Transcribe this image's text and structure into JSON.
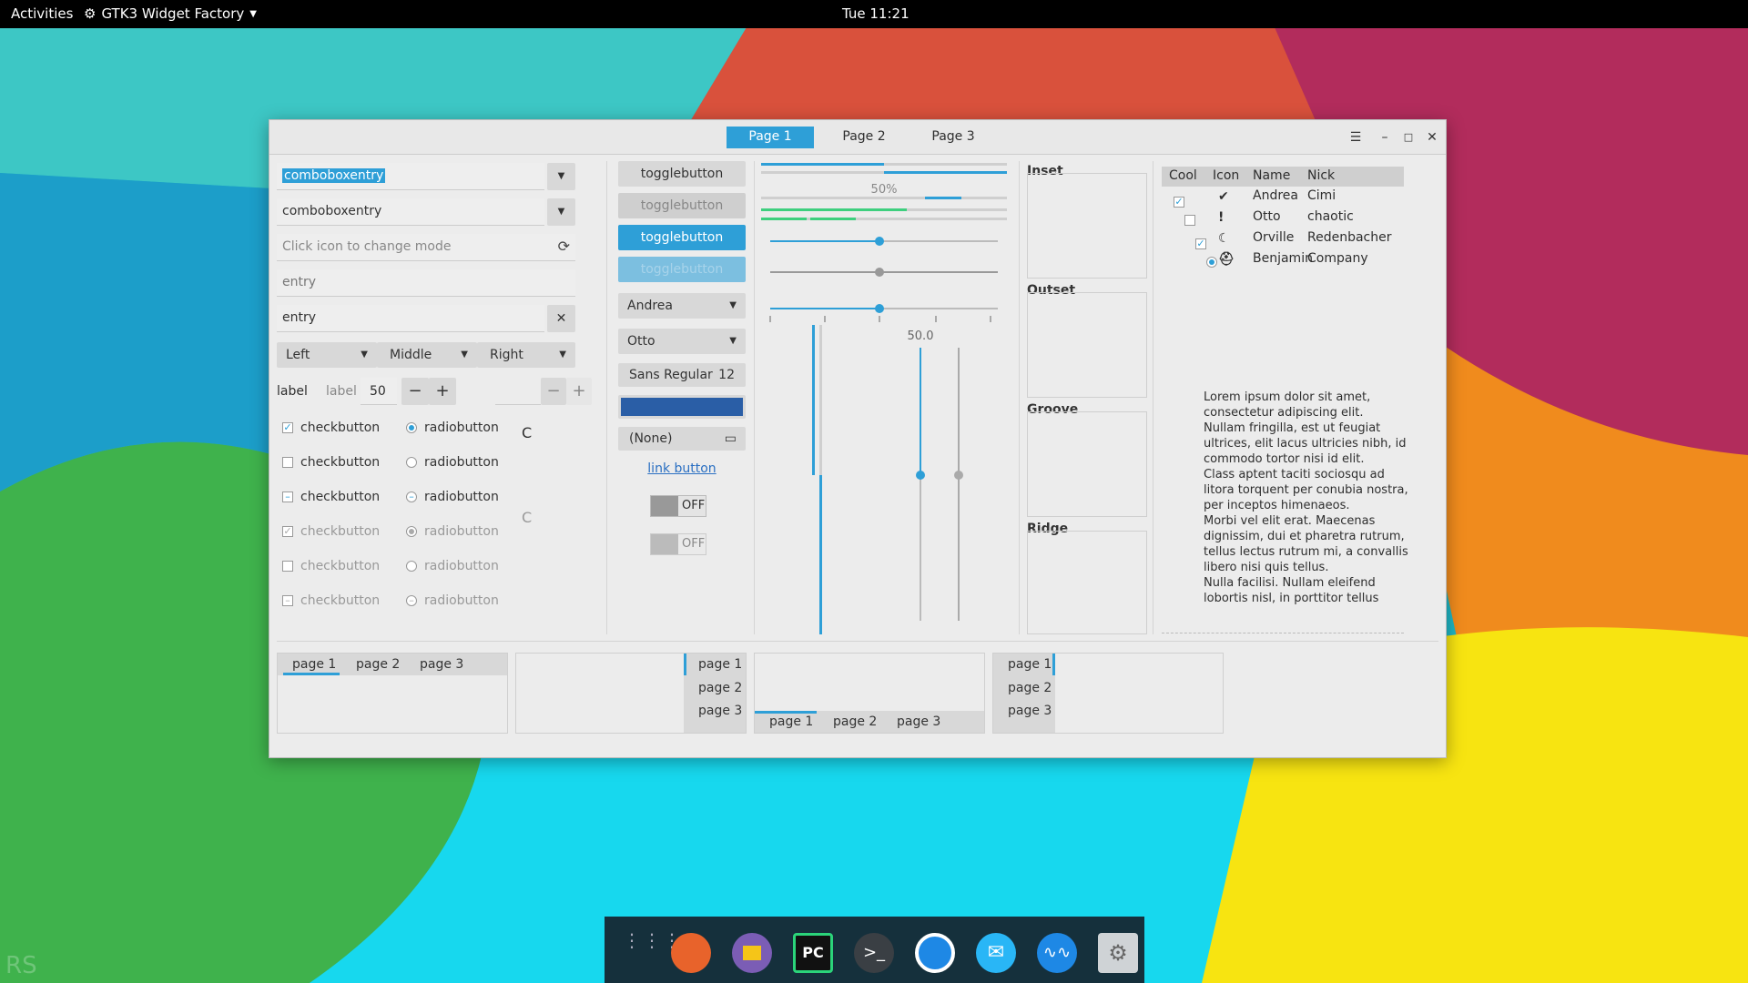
{
  "topbar": {
    "activities": "Activities",
    "app_name": "GTK3 Widget Factory",
    "clock": "Tue 11:21"
  },
  "watermark": "RS",
  "window": {
    "tabs": [
      "Page 1",
      "Page 2",
      "Page 3"
    ],
    "active_tab": "Page 1",
    "col1": {
      "combo1_value": "comboboxentry",
      "combo2_value": "comboboxentry",
      "icon_entry_placeholder": "Click icon to change mode",
      "entry1_placeholder": "entry",
      "entry2_value": "entry",
      "combos": [
        "Left",
        "Middle",
        "Right"
      ],
      "label1": "label",
      "label2": "label",
      "spin_value": "50",
      "checks": [
        {
          "label": "checkbutton",
          "state": "checked",
          "disabled": false
        },
        {
          "label": "checkbutton",
          "state": "unchecked",
          "disabled": false
        },
        {
          "label": "checkbutton",
          "state": "mixed",
          "disabled": false
        },
        {
          "label": "checkbutton",
          "state": "checked",
          "disabled": true
        },
        {
          "label": "checkbutton",
          "state": "unchecked",
          "disabled": true
        },
        {
          "label": "checkbutton",
          "state": "mixed",
          "disabled": true
        }
      ],
      "radios": [
        {
          "label": "radiobutton",
          "state": "checked",
          "disabled": false
        },
        {
          "label": "radiobutton",
          "state": "unchecked",
          "disabled": false
        },
        {
          "label": "radiobutton",
          "state": "mixed",
          "disabled": false
        },
        {
          "label": "radiobutton",
          "state": "checked",
          "disabled": true
        },
        {
          "label": "radiobutton",
          "state": "unchecked",
          "disabled": true
        },
        {
          "label": "radiobutton",
          "state": "mixed",
          "disabled": true
        }
      ]
    },
    "col2": {
      "toggles": [
        "togglebutton",
        "togglebutton",
        "togglebutton",
        "togglebutton"
      ],
      "combo_andrea": "Andrea",
      "combo_otto": "Otto",
      "font_name": "Sans Regular",
      "font_size": "12",
      "color_value": "#2a5ea6",
      "file_none": "(None)",
      "link": "link button",
      "switch1": "OFF",
      "switch2": "OFF"
    },
    "col3": {
      "progress_text": "50%",
      "scale_value": "50.0",
      "progress_fraction": 0.5
    },
    "frames": [
      "Inset",
      "Outset",
      "Groove",
      "Ridge"
    ],
    "tree": {
      "headers": [
        "Cool",
        "Icon",
        "Name",
        "Nick"
      ],
      "rows": [
        {
          "cool": "checked",
          "icon": "check-circle-icon",
          "name": "Andrea",
          "nick": "Cimi"
        },
        {
          "cool": "unchecked",
          "icon": "warning-icon",
          "name": "Otto",
          "nick": "chaotic"
        },
        {
          "cool": "checked",
          "icon": "moon-icon",
          "name": "Orville",
          "nick": "Redenbacher"
        },
        {
          "cool": "radio",
          "icon": "helmet-icon",
          "name": "Benjamin",
          "nick": "Company"
        }
      ]
    },
    "lorem": [
      "Lorem ipsum dolor sit amet,",
      "consectetur adipiscing elit.",
      "Nullam fringilla, est ut feugiat",
      "ultrices, elit lacus ultricies nibh, id",
      "commodo tortor nisi id elit.",
      "Class aptent taciti sociosqu ad",
      "litora torquent per conubia nostra,",
      "per inceptos himenaeos.",
      "Morbi vel elit erat. Maecenas",
      "dignissim, dui et pharetra rutrum,",
      "tellus lectus rutrum mi, a convallis",
      "libero nisi quis tellus.",
      "Nulla facilisi. Nullam eleifend",
      "lobortis nisl, in porttitor tellus"
    ],
    "notebooks": [
      {
        "tabs": [
          "page 1",
          "page 2",
          "page 3"
        ]
      },
      {
        "tabs": [
          "page 1",
          "page 2",
          "page 3"
        ]
      },
      {
        "tabs": [
          "page 1",
          "page 2",
          "page 3"
        ]
      },
      {
        "tabs": [
          "page 1",
          "page 2",
          "page 3"
        ]
      }
    ]
  },
  "dock": {
    "apps": [
      "app-grid-icon",
      "firefox-icon",
      "files-icon",
      "pycharm-icon",
      "terminal-icon",
      "power-icon",
      "mail-icon",
      "audio-icon",
      "settings-icon"
    ]
  },
  "colors": {
    "accent": "#2e9fd7",
    "progress_green": "#4caf50",
    "dock": "#15303c"
  }
}
